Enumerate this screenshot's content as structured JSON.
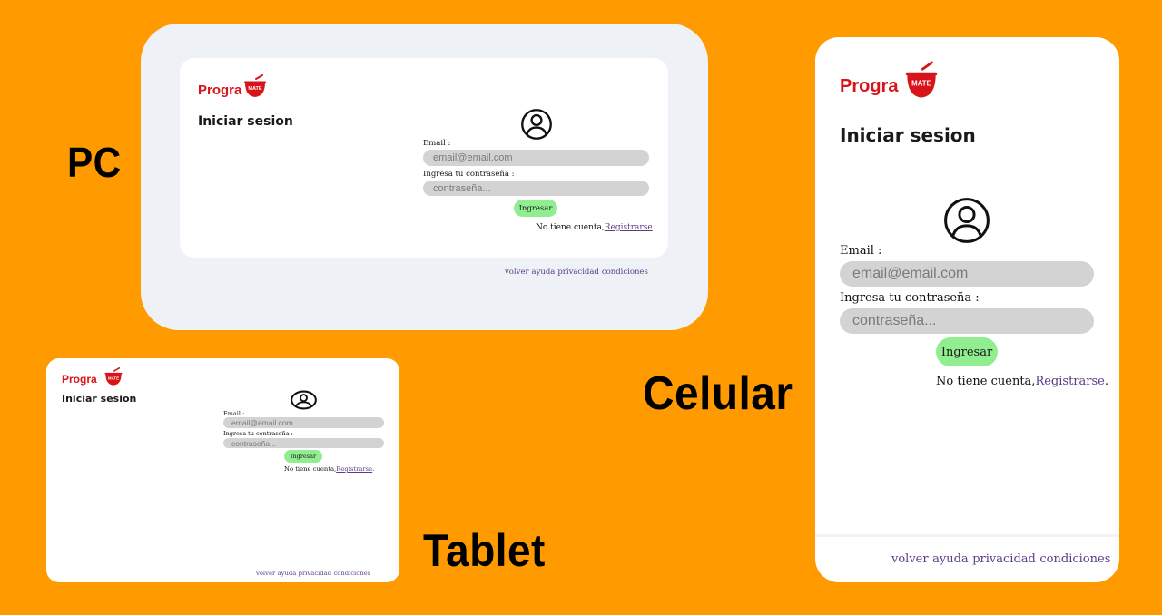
{
  "device_labels": {
    "pc": "PC",
    "tablet": "Tablet",
    "phone": "Celular"
  },
  "brand": {
    "text": "Progra",
    "badge": "MATE",
    "color": "#d8141a"
  },
  "login": {
    "title": "Iniciar sesion",
    "email_label": "Email :",
    "email_placeholder": "email@email.com",
    "password_label": "Ingresa tu contraseña :",
    "password_placeholder": "contraseña...",
    "submit_label": "Ingresar",
    "no_account_text": "No tiene cuenta,",
    "register_link": "Registrarse",
    "register_suffix": "."
  },
  "footer_links": [
    "volver",
    "ayuda",
    "privacidad",
    "condiciones"
  ],
  "colors": {
    "background": "#ff9a00",
    "pc_frame": "#eef1f5",
    "input_bg": "#d3d3d3",
    "button_bg": "#90ee90",
    "link": "#5b3c86"
  }
}
